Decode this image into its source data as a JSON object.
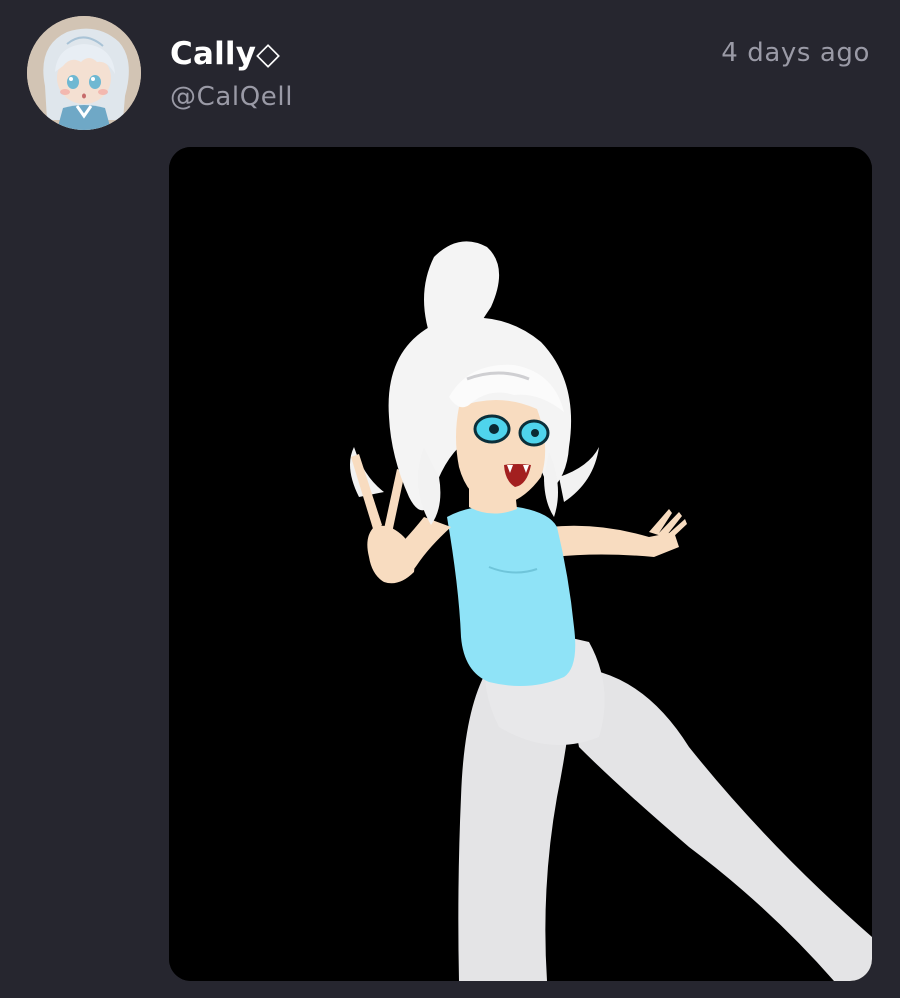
{
  "post": {
    "author": {
      "display_name": "Cally◇",
      "username": "@CalQell",
      "avatar_icon": "avatar-illustration"
    },
    "timestamp": "4 days ago",
    "image": {
      "icon": "character-illustration",
      "background_color": "#000000"
    }
  },
  "theme": {
    "background": "#26262f",
    "text_primary": "#ffffff",
    "text_secondary": "#9a9aa6"
  }
}
